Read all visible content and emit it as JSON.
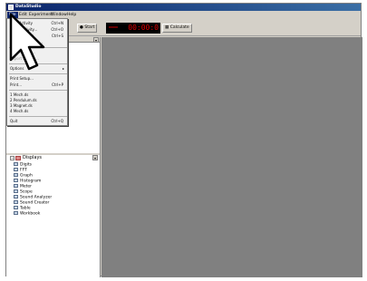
{
  "window": {
    "title": "DataStudio"
  },
  "menubar": {
    "items": [
      "File",
      "Edit",
      "Experiment",
      "Window",
      "Help"
    ]
  },
  "toolbar": {
    "start_label": "Start",
    "timer": "00:00:0",
    "calculate_label": "Calculate"
  },
  "file_menu": {
    "items": [
      {
        "label": "New Activity",
        "shortcut": "Ctrl+N",
        "enabled": true
      },
      {
        "label": "Open Activity...",
        "shortcut": "Ctrl+O",
        "enabled": true
      },
      {
        "label": "Save Activity",
        "shortcut": "Ctrl+S",
        "enabled": true
      },
      {
        "label": "Save Activity As...",
        "shortcut": "",
        "enabled": true
      },
      {
        "label": "Export Data...",
        "shortcut": "",
        "enabled": false
      },
      {
        "label": "Export Picture...",
        "shortcut": "",
        "enabled": false
      },
      {
        "label": "Options",
        "shortcut": "",
        "enabled": true,
        "submenu": true
      },
      {
        "label": "Print Setup...",
        "shortcut": "",
        "enabled": true
      },
      {
        "label": "Print...",
        "shortcut": "Ctrl+P",
        "enabled": true
      },
      {
        "label": "1 Mech.ds",
        "shortcut": "",
        "enabled": true
      },
      {
        "label": "2 Pendulum.ds",
        "shortcut": "",
        "enabled": true
      },
      {
        "label": "3 Magnet.ds",
        "shortcut": "",
        "enabled": true
      },
      {
        "label": "4 Mech.ds",
        "shortcut": "",
        "enabled": true
      },
      {
        "label": "Quit",
        "shortcut": "Ctrl+Q",
        "enabled": true
      }
    ]
  },
  "displays": {
    "header": "Displays",
    "items": [
      {
        "label": "Digits",
        "icon": "digits-icon"
      },
      {
        "label": "FFT",
        "icon": "fft-icon"
      },
      {
        "label": "Graph",
        "icon": "graph-icon"
      },
      {
        "label": "Histogram",
        "icon": "histogram-icon"
      },
      {
        "label": "Meter",
        "icon": "meter-icon"
      },
      {
        "label": "Scope",
        "icon": "scope-icon"
      },
      {
        "label": "Sound Analyzer",
        "icon": "sound-analyzer-icon"
      },
      {
        "label": "Sound Creator",
        "icon": "sound-creator-icon"
      },
      {
        "label": "Table",
        "icon": "table-icon"
      },
      {
        "label": "Workbook",
        "icon": "workbook-icon"
      }
    ]
  },
  "colors": {
    "titlebar": "#0a246a",
    "chrome": "#d4d0c8",
    "workspace": "#808080",
    "timer_text": "#e00000"
  }
}
